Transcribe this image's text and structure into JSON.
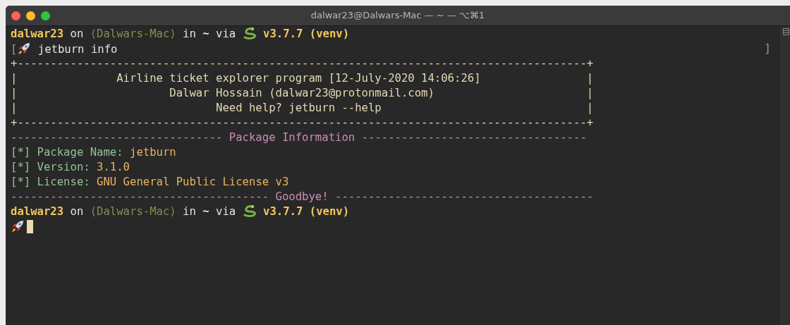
{
  "window": {
    "title": "dalwar23@Dalwars-Mac — ~ — ⌥⌘1"
  },
  "lines": [
    {
      "segments": [
        {
          "kind": "user",
          "text": "dalwar23"
        },
        {
          "kind": "plain",
          "text": " on "
        },
        {
          "kind": "host",
          "text": "⟨Dalwars-Mac⟩"
        },
        {
          "kind": "plain",
          "text": " in "
        },
        {
          "kind": "dir",
          "text": "~"
        },
        {
          "kind": "plain",
          "text": " via "
        },
        {
          "kind": "snake"
        },
        {
          "kind": "version",
          "text": " v3.7.7 (venv)"
        }
      ]
    },
    {
      "segments": [
        {
          "kind": "mark",
          "text": "["
        },
        {
          "kind": "rocket"
        },
        {
          "kind": "plain",
          "text": " jetburn info"
        }
      ],
      "end_mark": "]"
    },
    {
      "segments": [
        {
          "kind": "box",
          "text": "+--------------------------------------------------------------------------------------+"
        }
      ]
    },
    {
      "segments": [
        {
          "kind": "box",
          "text": "|               Airline ticket explorer program [12-July-2020 14:06:26]                |"
        }
      ]
    },
    {
      "segments": [
        {
          "kind": "box",
          "text": "|                       Dalwar Hossain (dalwar23@protonmail.com)                       |"
        }
      ]
    },
    {
      "segments": [
        {
          "kind": "box",
          "text": "|                              Need help? jetburn --help                               |"
        }
      ]
    },
    {
      "segments": [
        {
          "kind": "box",
          "text": "+--------------------------------------------------------------------------------------+"
        }
      ]
    },
    {
      "segments": [
        {
          "kind": "section",
          "text": "-------------------------------- Package Information ----------------------------------"
        }
      ]
    },
    {
      "segments": [
        {
          "kind": "label",
          "text": "[*] Package Name: "
        },
        {
          "kind": "value",
          "text": "jetburn"
        }
      ]
    },
    {
      "segments": [
        {
          "kind": "label",
          "text": "[*] Version: "
        },
        {
          "kind": "value",
          "text": "3.1.0"
        }
      ]
    },
    {
      "segments": [
        {
          "kind": "label",
          "text": "[*] License: "
        },
        {
          "kind": "value",
          "text": "GNU General Public License v3"
        }
      ]
    },
    {
      "segments": [
        {
          "kind": "section",
          "text": "--------------------------------------- Goodbye! ---------------------------------------"
        }
      ]
    },
    {
      "segments": [
        {
          "kind": "user",
          "text": "dalwar23"
        },
        {
          "kind": "plain",
          "text": " on "
        },
        {
          "kind": "host",
          "text": "⟨Dalwars-Mac⟩"
        },
        {
          "kind": "plain",
          "text": " in "
        },
        {
          "kind": "dir",
          "text": "~"
        },
        {
          "kind": "plain",
          "text": " via "
        },
        {
          "kind": "snake"
        },
        {
          "kind": "version",
          "text": " v3.7.7 (venv)"
        }
      ]
    },
    {
      "segments": [
        {
          "kind": "rocket"
        },
        {
          "kind": "cursor"
        }
      ]
    }
  ]
}
